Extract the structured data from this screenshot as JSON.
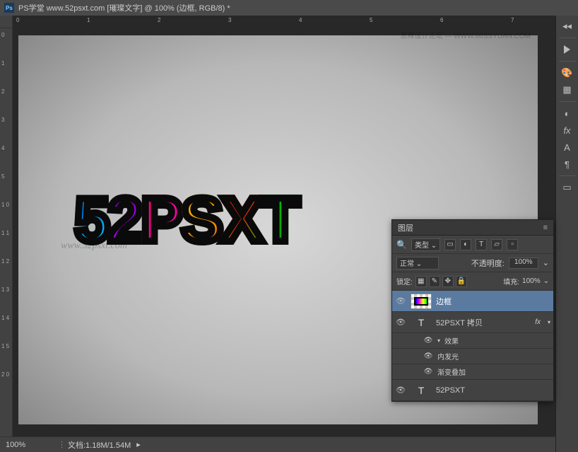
{
  "title": "PS学堂 www.52psxt.com [璀璨文字] @ 100% (边框, RGB/8) *",
  "forum_watermark": "思缘设计论坛 — WWW.MISSYUAN.COM",
  "canvas": {
    "url_watermark": "www.52psxt.com",
    "text_chars": [
      "5",
      "2",
      "P",
      "S",
      "X",
      "T"
    ]
  },
  "ruler_h": [
    "0",
    "1",
    "2",
    "3",
    "4",
    "5",
    "6",
    "7"
  ],
  "ruler_v": [
    "0",
    "1",
    "2",
    "3",
    "4",
    "5",
    "1 0",
    "1 1",
    "1 2",
    "1 3",
    "1 4",
    "1 5",
    "2 0"
  ],
  "status": {
    "zoom": "100%",
    "doc": "文档:1.18M/1.54M"
  },
  "layers_panel": {
    "title": "图层",
    "search_kind": "类型",
    "blend_mode": "正常",
    "opacity_label": "不透明度:",
    "opacity_value": "100%",
    "lock_label": "锁定:",
    "fill_label": "填充:",
    "fill_value": "100%",
    "items": [
      {
        "name": "边框",
        "type": "pixel",
        "selected": true
      },
      {
        "name": "52PSXT 拷贝",
        "type": "text",
        "fx": true,
        "effects_label": "效果",
        "effects": [
          "内发光",
          "渐变叠加"
        ]
      },
      {
        "name": "52PSXT",
        "type": "text"
      }
    ]
  },
  "icons": {
    "magnify": "🔍",
    "eye": "👁",
    "type": "T",
    "image": "▭",
    "adjust": "◐",
    "shape": "▱",
    "gear": "⚙",
    "swatch": "▦",
    "lock": "🔒",
    "brush": "✎",
    "link": "⧉",
    "menu": "≡",
    "fx": "fx",
    "play": "▶",
    "para": "¶",
    "text_a": "A"
  }
}
